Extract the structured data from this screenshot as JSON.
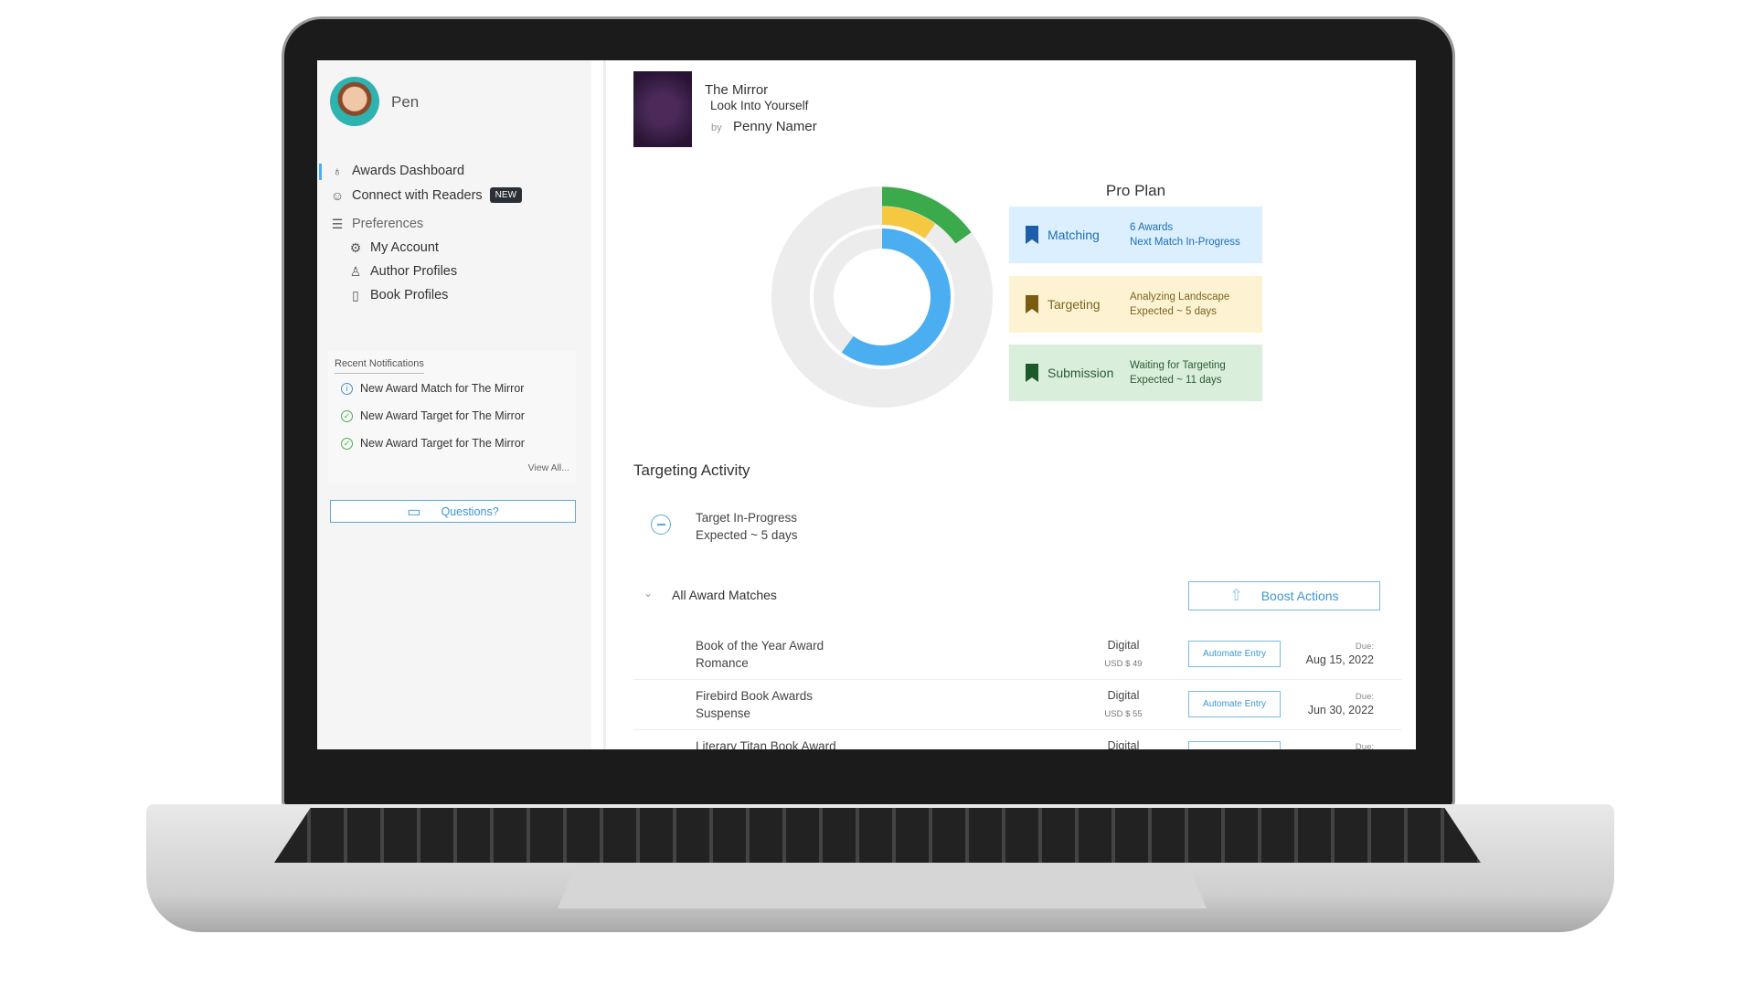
{
  "user": {
    "name": "Pen"
  },
  "sidebar": {
    "items": [
      {
        "label": "Awards Dashboard",
        "icon": "award-icon",
        "active": true
      },
      {
        "label": "Connect with Readers",
        "icon": "users-icon",
        "badge": "NEW"
      },
      {
        "label": "Preferences",
        "icon": "sliders-icon"
      },
      {
        "label": "My Account",
        "icon": "gear-icon"
      },
      {
        "label": "Author Profiles",
        "icon": "user-icon"
      },
      {
        "label": "Book Profiles",
        "icon": "book-icon"
      }
    ]
  },
  "notifications": {
    "title": "Recent Notifications",
    "items": [
      {
        "text": "New Award Match for The Mirror",
        "icon": "info-icon",
        "color": "#4a90c8"
      },
      {
        "text": "New Award Target for The Mirror",
        "icon": "check-circle-icon",
        "color": "#4caf50"
      },
      {
        "text": "New Award Target for The Mirror",
        "icon": "check-circle-icon",
        "color": "#4caf50"
      }
    ],
    "view_all": "View All..."
  },
  "questions_label": "Questions?",
  "book": {
    "title": "The Mirror",
    "subtitle": "Look Into Yourself",
    "by": "by",
    "author": "Penny Namer"
  },
  "progress": {
    "matching": 0.15,
    "targeting": 0.1,
    "submission": 0.6,
    "colors": {
      "matching": "#3aaa4a",
      "targeting": "#f5c842",
      "submission": "#4aaef0",
      "track": "#ececec"
    }
  },
  "plan": {
    "title": "Pro Plan",
    "stages": [
      {
        "label": "Matching",
        "line1": "6 Awards",
        "line2": "Next Match In-Progress",
        "bg": "#dcefff",
        "fg": "#1e6fb0",
        "icon": "#1c5fa8"
      },
      {
        "label": "Targeting",
        "line1": "Analyzing Landscape",
        "line2": "Expected ~ 5 days",
        "bg": "#fdf3d2",
        "fg": "#7a6420",
        "icon": "#7a5b12"
      },
      {
        "label": "Submission",
        "line1": "Waiting for Targeting",
        "line2": "Expected ~ 11 days",
        "bg": "#d9efdc",
        "fg": "#2d5a35",
        "icon": "#1d5a2a"
      }
    ]
  },
  "activity": {
    "title": "Targeting Activity",
    "status": "Target In-Progress",
    "expected": "Expected ~ 5 days"
  },
  "matches": {
    "title": "All Award Matches",
    "boost_label": "Boost Actions",
    "rows": [
      {
        "name": "Book of the Year Award",
        "genre": "Romance",
        "format": "Digital",
        "price": "USD $ 49",
        "action": "Automate Entry",
        "due_label": "Due:",
        "due": "Aug 15, 2022"
      },
      {
        "name": "Firebird Book Awards",
        "genre": "Suspense",
        "format": "Digital",
        "price": "USD $ 55",
        "action": "Automate Entry",
        "due_label": "Due:",
        "due": "Jun 30, 2022"
      },
      {
        "name": "Literary Titan Book Award",
        "genre": "",
        "format": "Digital",
        "price": "",
        "action": "",
        "due_label": "Due:",
        "due": ""
      }
    ]
  }
}
